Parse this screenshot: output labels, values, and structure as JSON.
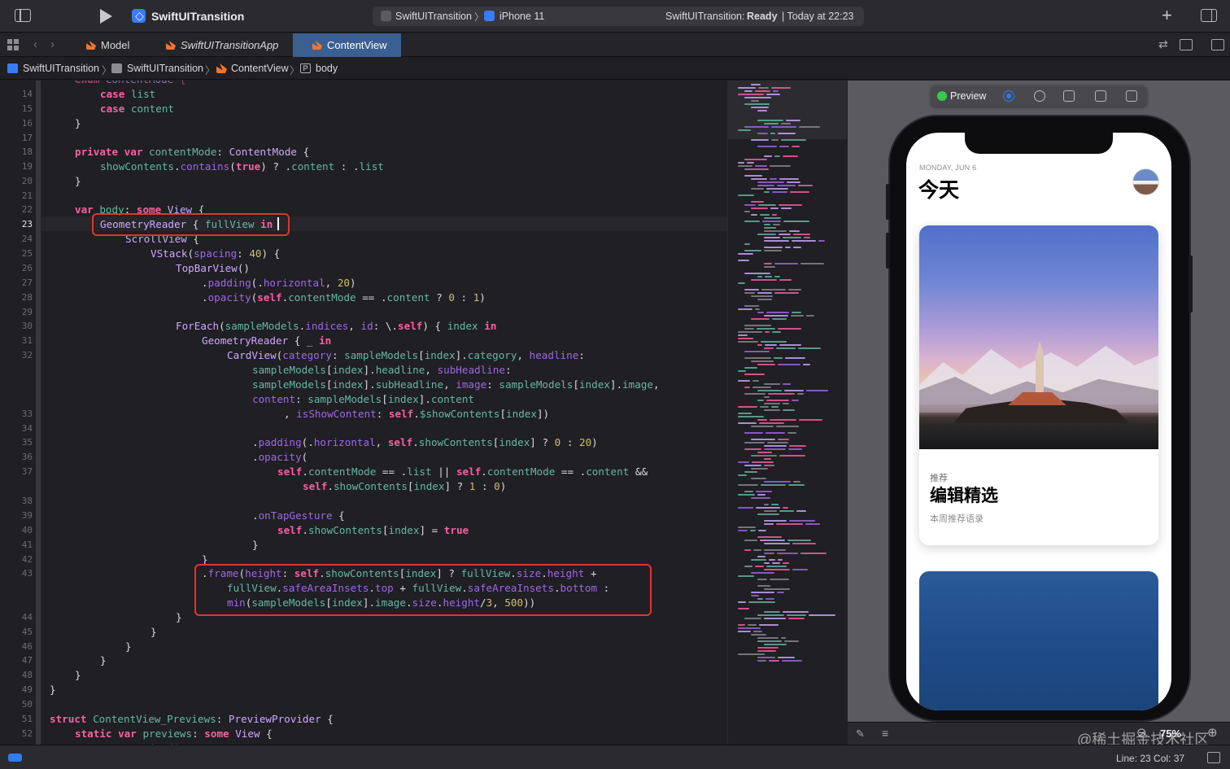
{
  "toolbar": {
    "project_name": "SwiftUITransition",
    "scheme_target": "SwiftUITransition",
    "scheme_device": "iPhone 11",
    "status_prefix": "SwiftUITransition:",
    "status_state": "Ready",
    "status_time": "| Today at 22:23"
  },
  "tabs": [
    {
      "label": "Model",
      "active": false
    },
    {
      "label": "SwiftUITransitionApp",
      "active": false
    },
    {
      "label": "ContentView",
      "active": true
    }
  ],
  "breadcrumb": [
    "SwiftUITransition",
    "SwiftUITransition",
    "ContentView",
    "body"
  ],
  "breadcrumb_symbol_letter": "P",
  "editor": {
    "current_line": "23",
    "line_numbers": [
      "14",
      "15",
      "16",
      "17",
      "18",
      "19",
      "20",
      "21",
      "22",
      "23",
      "24",
      "25",
      "26",
      "27",
      "28",
      "29",
      "30",
      "31",
      "32",
      "33",
      "34",
      "35",
      "36",
      "37",
      "38",
      "39",
      "40",
      "41",
      "42",
      "43",
      "44",
      "45",
      "46",
      "47",
      "48",
      "49",
      "50",
      "51",
      "52"
    ]
  },
  "preview": {
    "label": "Preview",
    "app": {
      "date": "MONDAY, JUN 6",
      "title": "今天",
      "card": {
        "category": "推荐",
        "headline": "编辑精选",
        "sub_headline": "本周推荐语录"
      }
    },
    "zoom": "75%"
  },
  "watermark": "@稀土掘金技术社区",
  "status_bar": {
    "line_col": "Line: 23  Col: 37"
  },
  "colors": {
    "accent": "#2f7cf6",
    "keyword": "#fc5fa3",
    "type": "#d0a8ff",
    "identifier": "#67b7a4",
    "number": "#d0bf69",
    "highlight_box": "#e0352b",
    "preview_ready": "#3ac84b"
  }
}
